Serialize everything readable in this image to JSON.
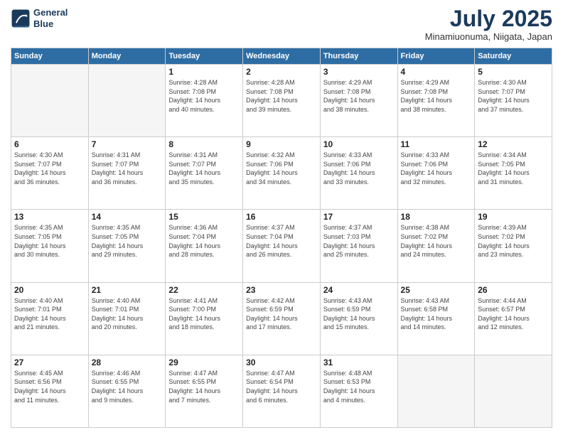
{
  "header": {
    "logo_line1": "General",
    "logo_line2": "Blue",
    "month": "July 2025",
    "location": "Minamiuonuma, Niigata, Japan"
  },
  "weekdays": [
    "Sunday",
    "Monday",
    "Tuesday",
    "Wednesday",
    "Thursday",
    "Friday",
    "Saturday"
  ],
  "weeks": [
    [
      {
        "day": "",
        "info": ""
      },
      {
        "day": "",
        "info": ""
      },
      {
        "day": "1",
        "info": "Sunrise: 4:28 AM\nSunset: 7:08 PM\nDaylight: 14 hours\nand 40 minutes."
      },
      {
        "day": "2",
        "info": "Sunrise: 4:28 AM\nSunset: 7:08 PM\nDaylight: 14 hours\nand 39 minutes."
      },
      {
        "day": "3",
        "info": "Sunrise: 4:29 AM\nSunset: 7:08 PM\nDaylight: 14 hours\nand 38 minutes."
      },
      {
        "day": "4",
        "info": "Sunrise: 4:29 AM\nSunset: 7:08 PM\nDaylight: 14 hours\nand 38 minutes."
      },
      {
        "day": "5",
        "info": "Sunrise: 4:30 AM\nSunset: 7:07 PM\nDaylight: 14 hours\nand 37 minutes."
      }
    ],
    [
      {
        "day": "6",
        "info": "Sunrise: 4:30 AM\nSunset: 7:07 PM\nDaylight: 14 hours\nand 36 minutes."
      },
      {
        "day": "7",
        "info": "Sunrise: 4:31 AM\nSunset: 7:07 PM\nDaylight: 14 hours\nand 36 minutes."
      },
      {
        "day": "8",
        "info": "Sunrise: 4:31 AM\nSunset: 7:07 PM\nDaylight: 14 hours\nand 35 minutes."
      },
      {
        "day": "9",
        "info": "Sunrise: 4:32 AM\nSunset: 7:06 PM\nDaylight: 14 hours\nand 34 minutes."
      },
      {
        "day": "10",
        "info": "Sunrise: 4:33 AM\nSunset: 7:06 PM\nDaylight: 14 hours\nand 33 minutes."
      },
      {
        "day": "11",
        "info": "Sunrise: 4:33 AM\nSunset: 7:06 PM\nDaylight: 14 hours\nand 32 minutes."
      },
      {
        "day": "12",
        "info": "Sunrise: 4:34 AM\nSunset: 7:05 PM\nDaylight: 14 hours\nand 31 minutes."
      }
    ],
    [
      {
        "day": "13",
        "info": "Sunrise: 4:35 AM\nSunset: 7:05 PM\nDaylight: 14 hours\nand 30 minutes."
      },
      {
        "day": "14",
        "info": "Sunrise: 4:35 AM\nSunset: 7:05 PM\nDaylight: 14 hours\nand 29 minutes."
      },
      {
        "day": "15",
        "info": "Sunrise: 4:36 AM\nSunset: 7:04 PM\nDaylight: 14 hours\nand 28 minutes."
      },
      {
        "day": "16",
        "info": "Sunrise: 4:37 AM\nSunset: 7:04 PM\nDaylight: 14 hours\nand 26 minutes."
      },
      {
        "day": "17",
        "info": "Sunrise: 4:37 AM\nSunset: 7:03 PM\nDaylight: 14 hours\nand 25 minutes."
      },
      {
        "day": "18",
        "info": "Sunrise: 4:38 AM\nSunset: 7:02 PM\nDaylight: 14 hours\nand 24 minutes."
      },
      {
        "day": "19",
        "info": "Sunrise: 4:39 AM\nSunset: 7:02 PM\nDaylight: 14 hours\nand 23 minutes."
      }
    ],
    [
      {
        "day": "20",
        "info": "Sunrise: 4:40 AM\nSunset: 7:01 PM\nDaylight: 14 hours\nand 21 minutes."
      },
      {
        "day": "21",
        "info": "Sunrise: 4:40 AM\nSunset: 7:01 PM\nDaylight: 14 hours\nand 20 minutes."
      },
      {
        "day": "22",
        "info": "Sunrise: 4:41 AM\nSunset: 7:00 PM\nDaylight: 14 hours\nand 18 minutes."
      },
      {
        "day": "23",
        "info": "Sunrise: 4:42 AM\nSunset: 6:59 PM\nDaylight: 14 hours\nand 17 minutes."
      },
      {
        "day": "24",
        "info": "Sunrise: 4:43 AM\nSunset: 6:59 PM\nDaylight: 14 hours\nand 15 minutes."
      },
      {
        "day": "25",
        "info": "Sunrise: 4:43 AM\nSunset: 6:58 PM\nDaylight: 14 hours\nand 14 minutes."
      },
      {
        "day": "26",
        "info": "Sunrise: 4:44 AM\nSunset: 6:57 PM\nDaylight: 14 hours\nand 12 minutes."
      }
    ],
    [
      {
        "day": "27",
        "info": "Sunrise: 4:45 AM\nSunset: 6:56 PM\nDaylight: 14 hours\nand 11 minutes."
      },
      {
        "day": "28",
        "info": "Sunrise: 4:46 AM\nSunset: 6:55 PM\nDaylight: 14 hours\nand 9 minutes."
      },
      {
        "day": "29",
        "info": "Sunrise: 4:47 AM\nSunset: 6:55 PM\nDaylight: 14 hours\nand 7 minutes."
      },
      {
        "day": "30",
        "info": "Sunrise: 4:47 AM\nSunset: 6:54 PM\nDaylight: 14 hours\nand 6 minutes."
      },
      {
        "day": "31",
        "info": "Sunrise: 4:48 AM\nSunset: 6:53 PM\nDaylight: 14 hours\nand 4 minutes."
      },
      {
        "day": "",
        "info": ""
      },
      {
        "day": "",
        "info": ""
      }
    ]
  ]
}
